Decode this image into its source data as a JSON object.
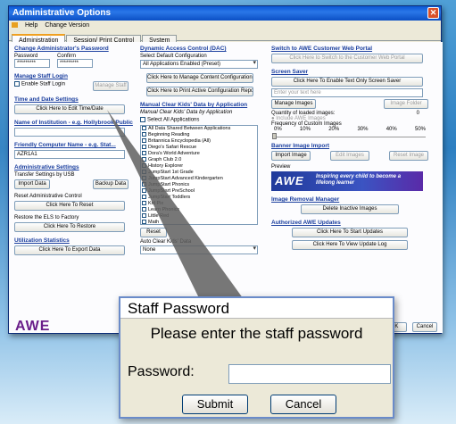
{
  "window": {
    "title": "Administrative Options",
    "menu": [
      "Help",
      "Change Version"
    ],
    "tabs": [
      "Administration",
      "Session/ Print Control",
      "System"
    ]
  },
  "col1": {
    "change_pw_title": "Change Administrator's Password",
    "password_label": "Password",
    "confirm_label": "Confirm",
    "password_value": "*********",
    "confirm_value": "*********",
    "manage_login_title": "Manage Staff Login",
    "enable_staff_login": "Enable Staff Login",
    "manage_staff": "Manage Staff",
    "time_date_title": "Time and Date Settings",
    "edit_time_date": "Click Here to Edit Time/Date",
    "institution_title": "Name of Institution - e.g. Hollybrook Public",
    "computer_name_title": "Friendly Computer Name - e.g. Stat...",
    "computer_name_value": "AZR1A1",
    "admin_settings_title": "Administrative Settings",
    "transfer_label": "Transfer Settings by USB",
    "import_data": "Import Data",
    "backup_data": "Backup Data",
    "reset_admin_label": "Reset Administrative Control",
    "click_reset": "Click Here To Reset",
    "restore_label": "Restore the ELS to Factory",
    "click_restore": "Click Here To Restore",
    "utilization_title": "Utilization Statistics",
    "export_data": "Click Here To Export Data"
  },
  "col2": {
    "dac_title": "Dynamic Access Control (DAC)",
    "select_default": "Select Default Configuration",
    "dac_value": "All Applications Enabled (Preset)",
    "manage_content": "Click Here to Manage Content Configurations",
    "print_active": "Click Here to Print Active Configuration Report",
    "manual_clear_title": "Manual Clear Kids' Data by Application",
    "manual_clear_sub": "Manual Clear Kids' Data by Application",
    "select_all": "Select All Applications",
    "apps": [
      "All Data Shared Between Applications",
      "Beginning Reading",
      "Britannica Encyclopedia (All)",
      "Diego's Safari Rescue",
      "Dora's World Adventure",
      "Graph Club 2.0",
      "History Explorer",
      "JumpStart 1st Grade",
      "JumpStart Advanced Kindergarten",
      "JumpStart Phonics",
      "JumpStart PreSchool",
      "JumpStart Toddlers",
      "Kid Pix",
      "Learn Phonics",
      "Little Red",
      "Math"
    ],
    "reset_label": "Reset",
    "auto_clear_label": "Auto Clear Kids' Data",
    "auto_clear_value": "None"
  },
  "col3": {
    "switch_title": "Switch to AWE Customer Web Portal",
    "switch_btn": "Click Here to Switch to the Customer Web Portal",
    "screen_saver_title": "Screen Saver",
    "enable_saver": "Click Here To Enable Text Only Screen Saver",
    "saver_placeholder": "Enter your text here",
    "manage_images": "Manage Images",
    "image_folder": "Image Folder",
    "qty_label": "Quantity of loaded images:",
    "qty_value": "0",
    "include_awe": "Include AWE Images",
    "freq_label": "Frequency of Custom Images",
    "freq_ticks": [
      "0%",
      "10%",
      "20%",
      "30%",
      "40%",
      "50%"
    ],
    "banner_title": "Banner Image Import",
    "import_image": "Import Image",
    "edit_images": "Edit Images",
    "reset_image": "Reset Image",
    "preview_label": "Preview",
    "promo_brand": "AWE",
    "promo_tag": "Inspiring every child to become a lifelong learner",
    "removal_title": "Image Removal Manager",
    "delete_inactive": "Delete Inactive Images",
    "updates_title": "Authorized AWE Updates",
    "start_updates": "Click Here To Start Updates",
    "view_log": "Click Here To View Update Log"
  },
  "footer": {
    "logo": "AWE",
    "ok": "OK",
    "cancel": "Cancel"
  },
  "dialog": {
    "title": "Staff Password",
    "message": "Please enter the staff password",
    "password_label": "Password:",
    "password_value": "",
    "submit": "Submit",
    "cancel": "Cancel"
  }
}
